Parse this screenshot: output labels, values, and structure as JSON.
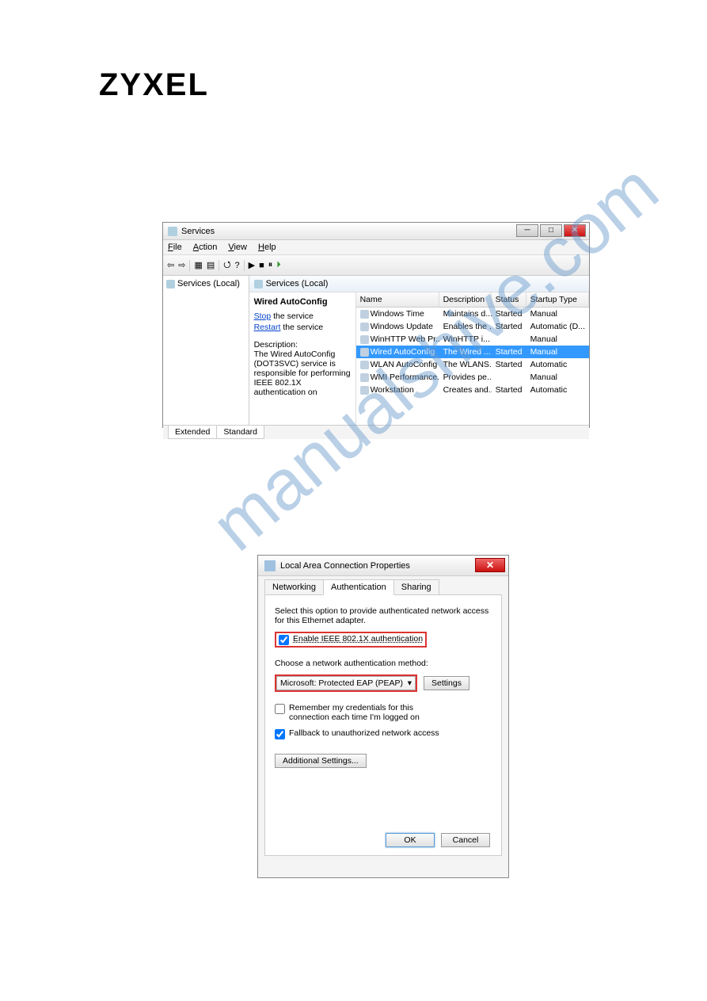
{
  "logo": "ZYXEL",
  "watermark": "manualshive.com",
  "services": {
    "windowTitle": "Services",
    "menus": [
      "File",
      "Action",
      "View",
      "Help"
    ],
    "treeItem": "Services (Local)",
    "panelHeader": "Services (Local)",
    "detail": {
      "title": "Wired AutoConfig",
      "stopLink": "Stop",
      "stopText": " the service",
      "restartLink": "Restart",
      "restartText": " the service",
      "descLabel": "Description:",
      "descText": "The Wired AutoConfig (DOT3SVC) service is responsible for performing IEEE 802.1X authentication on"
    },
    "columns": {
      "name": "Name",
      "desc": "Description",
      "status": "Status",
      "startup": "Startup Type"
    },
    "rows": [
      {
        "name": "Windows Time",
        "desc": "Maintains d...",
        "status": "Started",
        "startup": "Manual",
        "selected": false
      },
      {
        "name": "Windows Update",
        "desc": "Enables the ...",
        "status": "Started",
        "startup": "Automatic (D...",
        "selected": false
      },
      {
        "name": "WinHTTP Web Pr...",
        "desc": "WinHTTP i...",
        "status": "",
        "startup": "Manual",
        "selected": false
      },
      {
        "name": "Wired AutoConfig",
        "desc": "The Wired ...",
        "status": "Started",
        "startup": "Manual",
        "selected": true
      },
      {
        "name": "WLAN AutoConfig",
        "desc": "The WLANS...",
        "status": "Started",
        "startup": "Automatic",
        "selected": false
      },
      {
        "name": "WMI Performance...",
        "desc": "Provides pe...",
        "status": "",
        "startup": "Manual",
        "selected": false
      },
      {
        "name": "Workstation",
        "desc": "Creates and...",
        "status": "Started",
        "startup": "Automatic",
        "selected": false
      }
    ],
    "bottomTabs": [
      "Extended",
      "Standard"
    ]
  },
  "lan": {
    "title": "Local Area Connection Properties",
    "tabs": [
      "Networking",
      "Authentication",
      "Sharing"
    ],
    "intro": "Select this option to provide authenticated network access for this Ethernet adapter.",
    "enable8021x": "Enable IEEE 802.1X authentication",
    "choose": "Choose a network authentication method:",
    "method": "Microsoft: Protected EAP (PEAP)",
    "settingsBtn": "Settings",
    "remember": "Remember my credentials for this connection each time I'm logged on",
    "fallback": "Fallback to unauthorized network access",
    "additional": "Additional Settings...",
    "ok": "OK",
    "cancel": "Cancel"
  }
}
